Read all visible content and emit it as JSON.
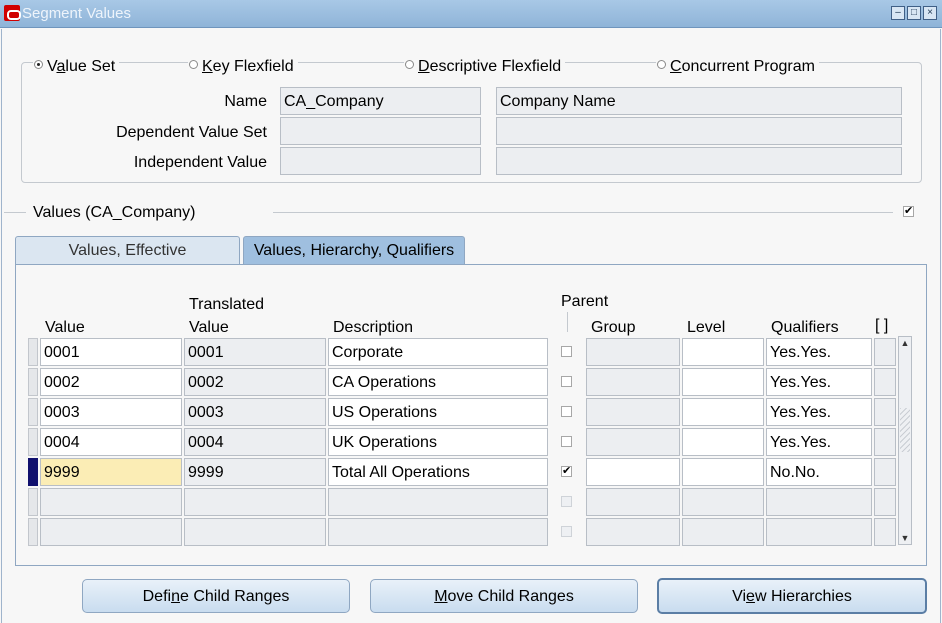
{
  "window": {
    "title": "Segment Values"
  },
  "selector": {
    "options": [
      {
        "pre": "V",
        "key": "a",
        "post": "lue Set",
        "selected": true
      },
      {
        "pre": "",
        "key": "K",
        "post": "ey Flexfield",
        "selected": false
      },
      {
        "pre": "",
        "key": "D",
        "post": "escriptive Flexfield",
        "selected": false
      },
      {
        "pre": "",
        "key": "C",
        "post": "oncurrent Program",
        "selected": false
      }
    ],
    "name_label": "Name",
    "name_value": "CA_Company",
    "name_desc": "Company Name",
    "dep_label": "Dependent Value Set",
    "dep_value": "",
    "dep_desc": "",
    "indep_label": "Independent Value",
    "indep_value": "",
    "indep_desc": ""
  },
  "values_section": {
    "title": "Values (CA_Company)",
    "checked": true
  },
  "tabs": [
    {
      "label": "Values, Effective",
      "active": false
    },
    {
      "label": "Values, Hierarchy, Qualifiers",
      "active": true
    }
  ],
  "table": {
    "headers": {
      "value": "Value",
      "translated_top": "Translated",
      "translated_bottom": "Value",
      "description": "Description",
      "parent": "Parent",
      "group": "Group",
      "level": "Level",
      "qualifiers": "Qualifiers",
      "extra": "[ ]"
    },
    "rows": [
      {
        "value": "0001",
        "translated": "0001",
        "description": "Corporate",
        "parent": false,
        "group": "",
        "level": "",
        "qualifiers": "Yes.Yes.",
        "current": false,
        "empty": false
      },
      {
        "value": "0002",
        "translated": "0002",
        "description": "CA Operations",
        "parent": false,
        "group": "",
        "level": "",
        "qualifiers": "Yes.Yes.",
        "current": false,
        "empty": false
      },
      {
        "value": "0003",
        "translated": "0003",
        "description": "US Operations",
        "parent": false,
        "group": "",
        "level": "",
        "qualifiers": "Yes.Yes.",
        "current": false,
        "empty": false
      },
      {
        "value": "0004",
        "translated": "0004",
        "description": "UK Operations",
        "parent": false,
        "group": "",
        "level": "",
        "qualifiers": "Yes.Yes.",
        "current": false,
        "empty": false
      },
      {
        "value": "9999",
        "translated": "9999",
        "description": "Total All Operations",
        "parent": true,
        "group": "",
        "level": "",
        "qualifiers": "No.No.",
        "current": true,
        "empty": false
      },
      {
        "value": "",
        "translated": "",
        "description": "",
        "parent": false,
        "group": "",
        "level": "",
        "qualifiers": "",
        "current": false,
        "empty": true
      },
      {
        "value": "",
        "translated": "",
        "description": "",
        "parent": false,
        "group": "",
        "level": "",
        "qualifiers": "",
        "current": false,
        "empty": true
      }
    ]
  },
  "buttons": [
    {
      "pre": "Defi",
      "key": "n",
      "post": "e Child Ranges"
    },
    {
      "pre": "",
      "key": "M",
      "post": "ove Child Ranges"
    },
    {
      "pre": "Vi",
      "key": "e",
      "post": "w Hierarchies"
    }
  ],
  "colors": {
    "titlebar": "#8fb4d8",
    "current_row": "#10106e",
    "current_cell": "#fbedb5",
    "tab_active": "#9fbfdf",
    "tab_inactive": "#dbe6f1"
  }
}
